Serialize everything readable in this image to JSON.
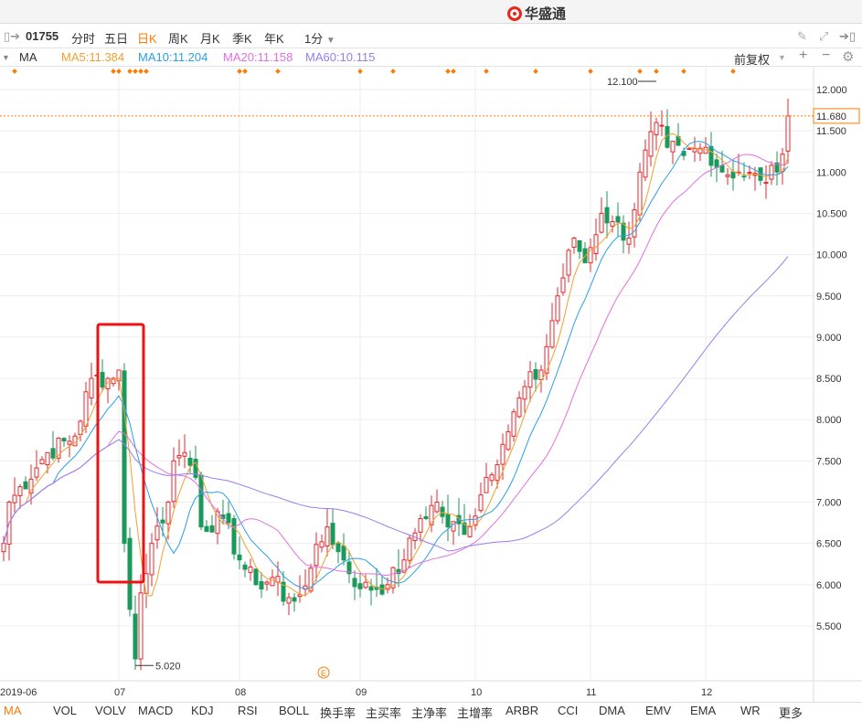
{
  "app": {
    "logo_text": "华盛通"
  },
  "toolbar": {
    "code": "01755",
    "periods": [
      "分时",
      "五日",
      "日K",
      "周K",
      "月K",
      "季K",
      "年K"
    ],
    "active_period": "日K",
    "minute_select": "1分"
  },
  "indicator_row": {
    "name": "MA",
    "ma5": "MA5:11.384",
    "ma10": "MA10:11.204",
    "ma20": "MA20:11.158",
    "ma60": "MA60:10.115",
    "adjust": "前复权"
  },
  "colors": {
    "up": "#e8262b",
    "down": "#1a9a5a",
    "ma5": "#f0a030",
    "ma10": "#2a9ee8",
    "ma20": "#e070e0",
    "ma60": "#9a7cf0",
    "accent": "#ff7a00"
  },
  "bottom_tabs": [
    "MA",
    "VOL",
    "VOLV",
    "MACD",
    "KDJ",
    "RSI",
    "BOLL",
    "换手率",
    "主买率",
    "主净率",
    "主增率",
    "ARBR",
    "CCI",
    "DMA",
    "EMV",
    "EMA",
    "WR",
    "更多"
  ],
  "chart_data": {
    "type": "candlestick",
    "x_ticks": [
      "2019-06",
      "07",
      "08",
      "09",
      "10",
      "11",
      "12"
    ],
    "x_tick_days": [
      0,
      21,
      43,
      65,
      86,
      107,
      128
    ],
    "y_ticks": [
      "12.000",
      "11.500",
      "11.000",
      "10.500",
      "10.000",
      "9.500",
      "9.000",
      "8.500",
      "8.000",
      "7.500",
      "7.000",
      "6.500",
      "6.000",
      "5.500"
    ],
    "ylim": [
      5.0,
      12.3
    ],
    "current_price": "11.680",
    "high_label": "12.100",
    "low_label": "5.020",
    "event_marker": "E",
    "close_keypoints": [
      [
        0,
        6.5
      ],
      [
        1,
        7.0
      ],
      [
        8,
        7.6
      ],
      [
        13,
        7.8
      ],
      [
        16,
        8.5
      ],
      [
        20,
        8.5
      ],
      [
        21,
        8.6
      ],
      [
        22,
        6.5
      ],
      [
        23,
        5.7
      ],
      [
        24,
        5.1
      ],
      [
        25,
        5.9
      ],
      [
        27,
        6.5
      ],
      [
        30,
        7.0
      ],
      [
        31,
        7.5
      ],
      [
        33,
        7.6
      ],
      [
        35,
        7.3
      ],
      [
        36,
        6.7
      ],
      [
        40,
        6.8
      ],
      [
        43,
        6.3
      ],
      [
        46,
        6.0
      ],
      [
        50,
        6.1
      ],
      [
        51,
        5.8
      ],
      [
        53,
        5.8
      ],
      [
        56,
        6.2
      ],
      [
        59,
        6.7
      ],
      [
        61,
        6.4
      ],
      [
        65,
        5.95
      ],
      [
        70,
        6.0
      ],
      [
        73,
        6.3
      ],
      [
        76,
        6.8
      ],
      [
        79,
        7.0
      ],
      [
        81,
        6.7
      ],
      [
        85,
        6.7
      ],
      [
        88,
        7.3
      ],
      [
        91,
        7.7
      ],
      [
        95,
        8.4
      ],
      [
        98,
        8.6
      ],
      [
        101,
        9.5
      ],
      [
        104,
        10.2
      ],
      [
        106,
        9.9
      ],
      [
        109,
        10.5
      ],
      [
        111,
        10.4
      ],
      [
        114,
        10.2
      ],
      [
        116,
        11.0
      ],
      [
        119,
        11.6
      ],
      [
        121,
        11.3
      ],
      [
        124,
        11.2
      ],
      [
        128,
        11.3
      ],
      [
        131,
        11.0
      ],
      [
        134,
        11.0
      ],
      [
        138,
        10.9
      ],
      [
        141,
        11.0
      ],
      [
        143,
        11.68
      ]
    ],
    "series": [
      {
        "name": "MA5"
      },
      {
        "name": "MA10"
      },
      {
        "name": "MA20"
      },
      {
        "name": "MA60"
      }
    ]
  }
}
